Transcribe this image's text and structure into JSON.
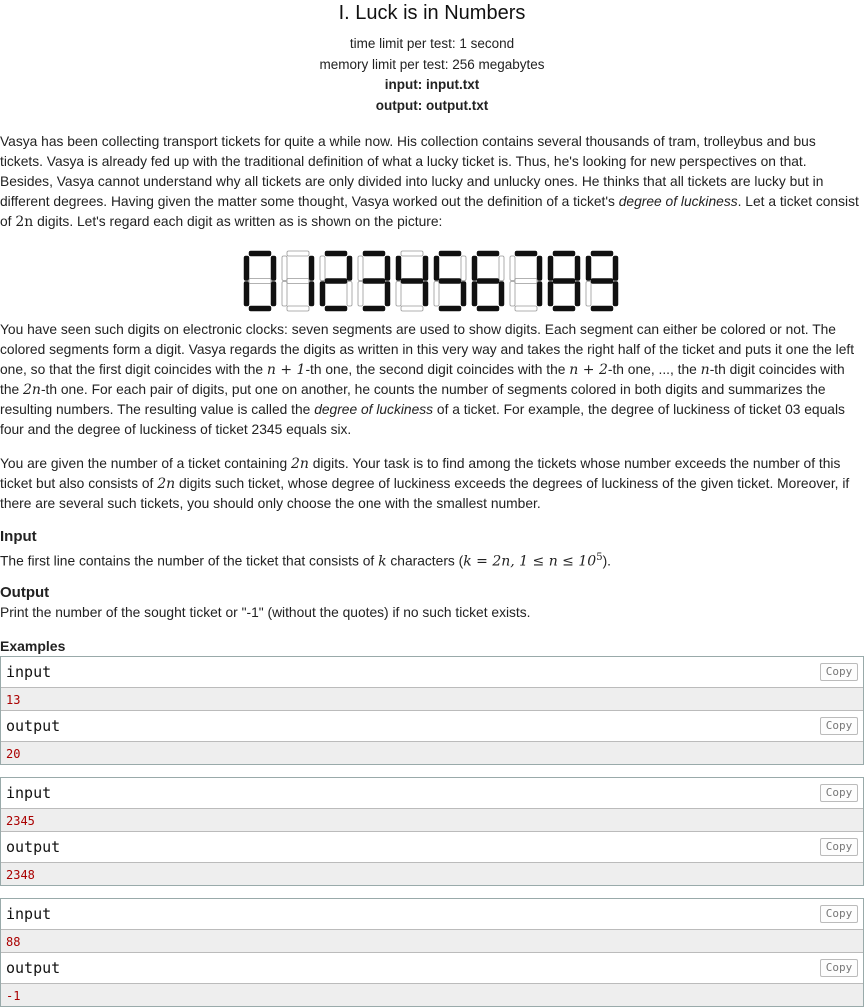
{
  "problem": {
    "title": "I. Luck is in Numbers",
    "time_limit": "time limit per test: 1 second",
    "memory_limit": "memory limit per test: 256 megabytes",
    "input_file": "input: input.txt",
    "output_file": "output: output.txt"
  },
  "statement": {
    "p1_a": "Vasya has been collecting transport tickets for quite a while now. His collection contains several thousands of tram, trolleybus and bus tickets. Vasya is already fed up with the traditional definition of what a lucky ticket is. Thus, he's looking for new perspectives on that. Besides, Vasya cannot understand why all tickets are only divided into lucky and unlucky ones. He thinks that all tickets are lucky but in different degrees. Having given the matter some thought, Vasya worked out the definition of a ticket's ",
    "p1_em": "degree of luckiness",
    "p1_b": ". Let a ticket consist of ",
    "p1_math": "2n",
    "p1_c": " digits. Let's regard each digit as written as is shown on the picture:",
    "p2_a": "You have seen such digits on electronic clocks: seven segments are used to show digits. Each segment can either be colored or not. The colored segments form a digit. Vasya regards the digits as written in this very way and takes the right half of the ticket and puts it one the left one, so that the first digit coincides with the ",
    "p2_m1": "n + 1",
    "p2_b": "-th one, the second digit coincides with the ",
    "p2_m2": "n + 2",
    "p2_c": "-th one, ..., the ",
    "p2_m3": "n",
    "p2_d": "-th digit coincides with the ",
    "p2_m4": "2n",
    "p2_e": "-th one. For each pair of digits, put one on another, he counts the number of segments colored in both digits and summarizes the resulting numbers. The resulting value is called the ",
    "p2_em": "degree of luckiness",
    "p2_f": " of a ticket. For example, the degree of luckiness of ticket 03 equals four and the degree of luckiness of ticket 2345 equals six.",
    "p3_a": "You are given the number of a ticket containing ",
    "p3_m1": "2n",
    "p3_b": " digits. Your task is to find among the tickets whose number exceeds the number of this ticket but also consists of ",
    "p3_m2": "2n",
    "p3_c": " digits such ticket, whose degree of luckiness exceeds the degrees of luckiness of the given ticket. Moreover, if there are several such tickets, you should only choose the one with the smallest number."
  },
  "input_section": {
    "header": "Input",
    "text_a": "The first line contains the number of the ticket that consists of ",
    "m_k": "k",
    "text_b": " characters (",
    "m_c": "k = 2n, 1 ≤ n ≤ 10",
    "m_sup": "5",
    "text_c": ")."
  },
  "output_section": {
    "header": "Output",
    "text": "Print the number of the sought ticket or \"-1\" (without the quotes) if no such ticket exists."
  },
  "examples": {
    "header": "Examples",
    "input_label": "input",
    "output_label": "output",
    "copy_label": "Copy",
    "tests": [
      {
        "input": "13",
        "output": "20"
      },
      {
        "input": "2345",
        "output": "2348"
      },
      {
        "input": "88",
        "output": "-1"
      }
    ]
  },
  "digits": [
    "0",
    "1",
    "2",
    "3",
    "4",
    "5",
    "6",
    "7",
    "8",
    "9"
  ]
}
